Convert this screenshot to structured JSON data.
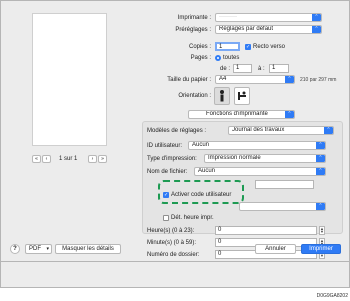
{
  "print": {
    "printer_label": "Imprimante :",
    "printer_value": "·········",
    "presets_label": "Préréglages :",
    "presets_value": "Réglages par défaut",
    "copies_label": "Copies :",
    "copies_value": "1",
    "recto_verso_label": "Recto verso",
    "pages_label": "Pages :",
    "pages_all_label": "toutes",
    "pages_from_label": "de :",
    "pages_from_value": "1",
    "pages_to_label": "à :",
    "pages_to_value": "1",
    "paper_size_label": "Taille du papier :",
    "paper_size_value": "A4",
    "paper_size_dims": "210 par 297 mm",
    "orientation_label": "Orientation :",
    "section_value": "Fonctions d'imprimante"
  },
  "preview": {
    "page_indicator": "1 sur 1",
    "first": "«",
    "prev": "‹",
    "next": "›",
    "last": "»"
  },
  "panel": {
    "settings_models_label": "Modèles de réglages :",
    "settings_models_value": "Journal des travaux",
    "user_id_label": "ID utilisateur:",
    "user_id_value": "Aucun",
    "print_type_label": "Type d'impression:",
    "print_type_value": "Impression normale",
    "filename_label": "Nom de fichier:",
    "filename_value": "Aucun",
    "activate_user_code_label": "Activer code utilisateur",
    "print_time_label": "Dét. heure impr.",
    "hour_label": "Heure(s) (0 à 23):",
    "hour_value": "0",
    "minute_label": "Minute(s) (0 à 59):",
    "minute_value": "0",
    "folder_label": "Numéro de dossier:",
    "folder_value": "0"
  },
  "footer": {
    "help": "?",
    "pdf": "PDF",
    "hide_details": "Masquer les détails",
    "cancel": "Annuler",
    "print": "Imprimer"
  },
  "figure_id": "D0G9GA8202",
  "colors": {
    "accent": "#2f7bf5",
    "highlight": "#1d9a52"
  }
}
